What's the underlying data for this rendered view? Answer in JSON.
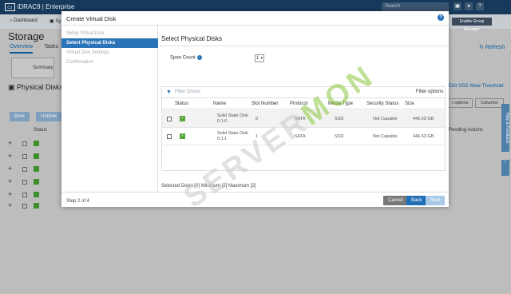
{
  "app": {
    "brand": "iDRAC9 | Enterprise",
    "search_placeholder": "Search",
    "nav": [
      "Dashboard",
      "Sy"
    ],
    "egm_button": "Enable Group Manager",
    "page_title": "Storage",
    "tabs": [
      "Overview",
      "Tasks"
    ],
    "refresh": "Refresh",
    "summary_label": "Summary",
    "physical_disks_title": "Physical Disks",
    "ssd_threshold": "Edit SSD Wear Threshold",
    "buttons": [
      "Blink",
      "Unblink"
    ],
    "filter_options": "r options",
    "columns": "Columns",
    "status_header": "Status",
    "pending_actions": "Pending Actions",
    "help_tab": "Help & Feedback"
  },
  "modal": {
    "title": "Create Virtual Disk",
    "steps": [
      {
        "label": "Setup Virtual Disk",
        "active": false
      },
      {
        "label": "Select Physical Disks",
        "active": true
      },
      {
        "label": "Virtual Disk Settings",
        "active": false
      },
      {
        "label": "Confirmation",
        "active": false
      }
    ],
    "section_title": "Select Physical Disks",
    "span_count_label": "Span Count",
    "span_count_value": "1",
    "filter_placeholder": "Filter Drives",
    "filter_options": "Filter options",
    "columns": [
      "Status",
      "Name",
      "Slot Number",
      "Protocol",
      "Media Type",
      "Security Status",
      "Size"
    ],
    "rows": [
      {
        "name_line1": "Solid State Disk",
        "name_line2": "0:1:0",
        "slot": "0",
        "protocol": "SATA",
        "media": "SSD",
        "security": "Not Capable",
        "size": "446.63 GB"
      },
      {
        "name_line1": "Solid State Disk",
        "name_line2": "0:1:1",
        "slot": "1",
        "protocol": "SATA",
        "media": "SSD",
        "security": "Not Capable",
        "size": "446.63 GB"
      }
    ],
    "selected_disks": "Selected Disks [0] Minimum [2] Maximum [2]",
    "step_count": "Step 2 of 4",
    "cancel": "Cancel",
    "back": "Back",
    "next": "Next"
  },
  "watermark": {
    "part1": "SERVER",
    "part2": "MON"
  }
}
